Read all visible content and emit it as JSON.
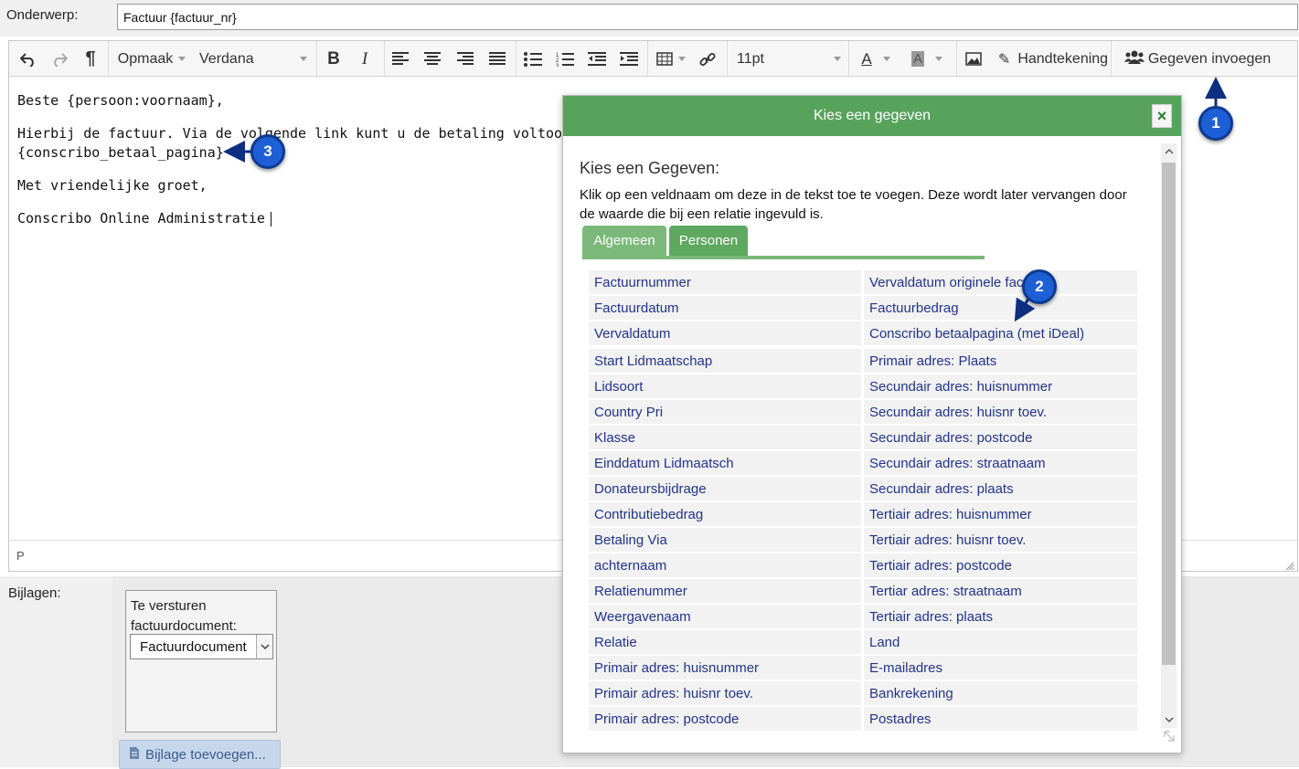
{
  "subject": {
    "label": "Onderwerp:",
    "value": "Factuur {factuur_nr}"
  },
  "toolbar": {
    "format_label": "Opmaak",
    "font_label": "Verdana",
    "size_label": "11pt",
    "signature_label": "Handtekening",
    "insert_data_label": "Gegeven invoegen"
  },
  "editor": {
    "lines": [
      "Beste {persoon:voornaam},",
      "Hierbij de factuur. Via de volgende link kunt u de betaling voltooien.",
      "{conscribo_betaal_pagina}",
      "Met vriendelijke groet,",
      "Conscribo Online Administratie"
    ],
    "status_path": "P"
  },
  "attachments": {
    "label": "Bijlagen:",
    "doc_label": "Te versturen factuurdocument:",
    "doc_value": "Factuurdocument",
    "add_label": "Bijlage toevoegen..."
  },
  "dialog": {
    "header": "Kies een gegeven",
    "close": "×",
    "title": "Kies een Gegeven:",
    "description": "Klik op een veldnaam om deze in de tekst toe te voegen. Deze wordt later vervangen door de waarde die bij een relatie ingevuld is.",
    "tabs": [
      "Algemeen",
      "Personen"
    ],
    "rows": [
      [
        "Factuurnummer",
        "Vervaldatum originele factuur"
      ],
      [
        "Factuurdatum",
        "Factuurbedrag"
      ],
      [
        "Vervaldatum",
        "Conscribo betaalpagina (met iDeal)"
      ],
      [
        "Start Lidmaatschap",
        "Primair adres: Plaats"
      ],
      [
        "Lidsoort",
        "Secundair adres: huisnummer"
      ],
      [
        "Country Pri",
        "Secundair adres: huisnr toev."
      ],
      [
        "Klasse",
        "Secundair adres: postcode"
      ],
      [
        "Einddatum Lidmaatsch",
        "Secundair adres: straatnaam"
      ],
      [
        "Donateursbijdrage",
        "Secundair adres: plaats"
      ],
      [
        "Contributiebedrag",
        "Tertiair adres: huisnummer"
      ],
      [
        "Betaling Via",
        "Tertiair adres: huisnr toev."
      ],
      [
        "achternaam",
        "Tertiair adres: postcode"
      ],
      [
        "Relatienummer",
        "Tertiar adres: straatnaam"
      ],
      [
        "Weergavenaam",
        "Tertiair adres: plaats"
      ],
      [
        "Relatie",
        "Land"
      ],
      [
        "Primair adres: huisnummer",
        "E-mailadres"
      ],
      [
        "Primair adres: huisnr toev.",
        "Bankrekening"
      ],
      [
        "Primair adres: postcode",
        "Postadres"
      ]
    ]
  },
  "markers": [
    "1",
    "2",
    "3"
  ],
  "colors": {
    "dialog_header": "#58a35c",
    "tab": "#5ea95f",
    "link": "#22338a",
    "marker": "#1f5fd6"
  }
}
